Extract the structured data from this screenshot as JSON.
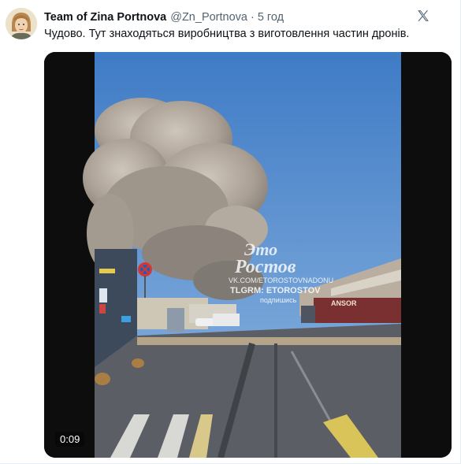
{
  "tweet": {
    "author_name": "Team of Zina Portnova",
    "handle": "@Zn_Portnova",
    "separator": "·",
    "time": "5 год",
    "text": "Чудово. Тут знаходяться виробництва з виготовлення частин дронів."
  },
  "video": {
    "duration": "0:09",
    "watermark_line1": "Это",
    "watermark_line2": "Ростов",
    "watermark_vk": "VK.COM/ETOROSTOVNADONU",
    "watermark_tg": "TLGRM: ETOROSTOV",
    "watermark_subscribe": "подпишись",
    "truck_text": "ANSOR"
  },
  "icons": {
    "x_logo": "x-logo-icon",
    "avatar": "avatar"
  },
  "colors": {
    "sky": "#4f86c9",
    "smoke": "#b8aea2",
    "asphalt": "#5a5d63",
    "accent_text": "#536471"
  }
}
